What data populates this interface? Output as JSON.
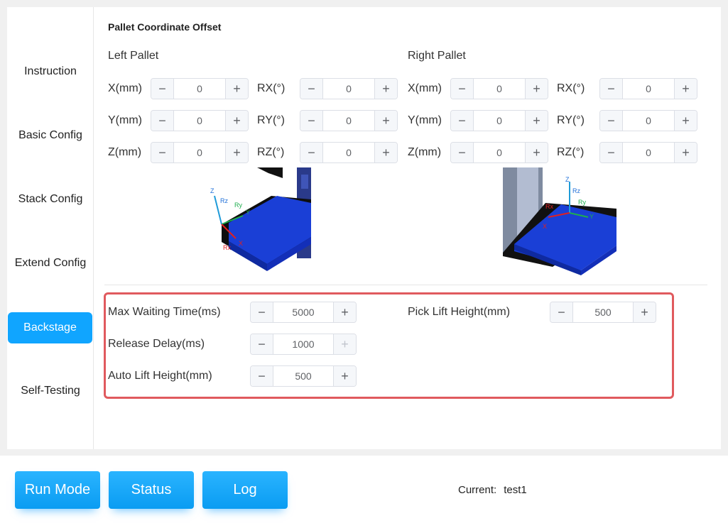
{
  "sidebar": {
    "items": [
      {
        "label": "Instruction"
      },
      {
        "label": "Basic Config"
      },
      {
        "label": "Stack Config"
      },
      {
        "label": "Extend Config"
      },
      {
        "label": "Backstage",
        "active": true
      },
      {
        "label": "Self-Testing"
      }
    ]
  },
  "offset": {
    "title": "Pallet Coordinate Offset",
    "left": {
      "title": "Left Pallet",
      "x_label": "X(mm)",
      "x_value": "0",
      "y_label": "Y(mm)",
      "y_value": "0",
      "z_label": "Z(mm)",
      "z_value": "0",
      "rx_label": "RX(°)",
      "rx_value": "0",
      "ry_label": "RY(°)",
      "ry_value": "0",
      "rz_label": "RZ(°)",
      "rz_value": "0"
    },
    "right": {
      "title": "Right Pallet",
      "x_label": "X(mm)",
      "x_value": "0",
      "y_label": "Y(mm)",
      "y_value": "0",
      "z_label": "Z(mm)",
      "z_value": "0",
      "rx_label": "RX(°)",
      "rx_value": "0",
      "ry_label": "RY(°)",
      "ry_value": "0",
      "rz_label": "RZ(°)",
      "rz_value": "0"
    }
  },
  "diagram_labels": {
    "z": "Z",
    "rz": "Rz",
    "ry": "Ry",
    "y": "Y",
    "rx": "Rx",
    "x": "X"
  },
  "backstage": {
    "max_wait_label": "Max Waiting Time(ms)",
    "max_wait_value": "5000",
    "release_delay_label": "Release Delay(ms)",
    "release_delay_value": "1000",
    "auto_lift_label": "Auto Lift Height(mm)",
    "auto_lift_value": "500",
    "pick_lift_label": "Pick Lift Height(mm)",
    "pick_lift_value": "500"
  },
  "stepper": {
    "minus": "−",
    "plus": "+"
  },
  "bottom": {
    "run_mode": "Run Mode",
    "status": "Status",
    "log": "Log",
    "current_label": "Current:",
    "current_value": "test1"
  },
  "colors": {
    "accent": "#10a5ff",
    "highlight": "#e05a5e",
    "pallet": "#1a3fd6"
  }
}
